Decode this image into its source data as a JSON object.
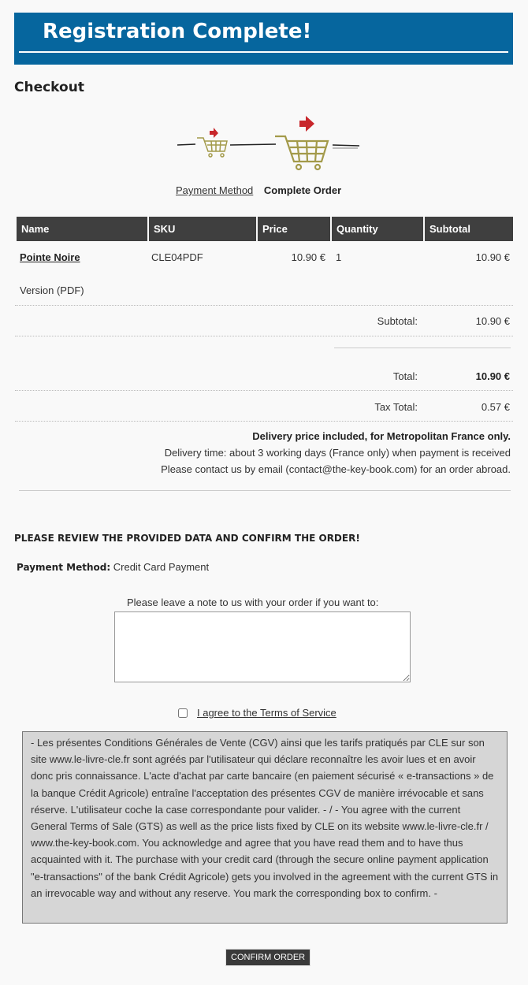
{
  "banner": {
    "title": "Registration Complete!"
  },
  "checkout_title": "Checkout",
  "steps": {
    "payment_method": "Payment Method",
    "complete_order": "Complete Order"
  },
  "cart": {
    "headers": [
      "Name",
      "SKU",
      "Price",
      "Quantity",
      "Subtotal"
    ],
    "items": [
      {
        "name": "Pointe Noire",
        "sku": "CLE04PDF",
        "price": "10.90 €",
        "quantity": "1",
        "subtotal": "10.90 €",
        "version": "Version (PDF)"
      }
    ],
    "subtotal_label": "Subtotal:",
    "subtotal_value": "10.90 €",
    "total_label": "Total:",
    "total_value": "10.90 €",
    "tax_label": "Tax Total:",
    "tax_value": "0.57 €"
  },
  "delivery": {
    "line1": "Delivery price included, for Metropolitan France only.",
    "line2": "Delivery time: about 3 working days (France only) when payment is received",
    "line3": "Please contact us by email (contact@the-key-book.com) for an order abroad."
  },
  "review_heading": "PLEASE REVIEW THE PROVIDED DATA AND CONFIRM THE ORDER!",
  "payment_method": {
    "label": "Payment Method:",
    "value": "Credit Card Payment"
  },
  "note": {
    "label": "Please leave a note to us with your order if you want to:",
    "value": ""
  },
  "agree_label": "I agree to the Terms of Service",
  "terms_text": "- Les présentes Conditions Générales de Vente (CGV) ainsi que les tarifs pratiqués par CLE sur son site www.le-livre-cle.fr sont agréés par l'utilisateur qui déclare reconnaître les avoir lues et en avoir donc pris connaissance. L'acte d'achat par carte bancaire (en paiement sécurisé « e-transactions » de la banque Crédit Agricole) entraîne l'acceptation des présentes CGV de manière irrévocable et sans réserve. L'utilisateur coche la case correspondante pour valider. - / - You agree with the current General Terms of Sale (GTS) as well as the price lists fixed by CLE on its website www.le-livre-cle.fr / www.the-key-book.com. You acknowledge and agree that you have read them and to have thus acquainted with it. The purchase with your credit card (through the secure online payment application \"e-transactions\" of the bank Crédit Agricole) gets you involved in the agreement with the current GTS in an irrevocable way and without any reserve. You mark the corresponding box to confirm. -",
  "confirm_label": "CONFIRM ORDER",
  "colors": {
    "banner": "#06669e",
    "table_header": "#3f3f3f",
    "cart_icon": "#a39a4a",
    "arrow": "#c8262b"
  }
}
